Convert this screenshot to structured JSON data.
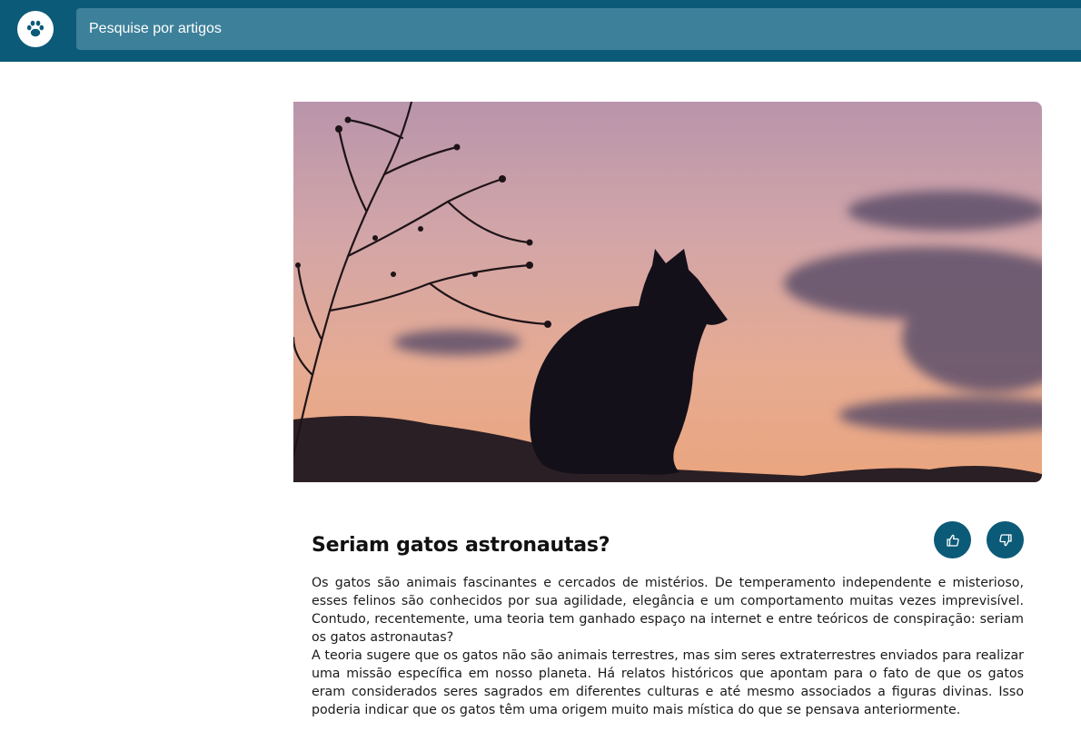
{
  "header": {
    "logo_icon": "paw-icon",
    "search_placeholder": "Pesquise por artigos",
    "background_color": "#0b5a78",
    "search_color": "#3d809a"
  },
  "article": {
    "image_description_icon": "cat-silhouette-sunset-image",
    "title": "Seriam gatos astronautas?",
    "like_icon": "thumbs-up-icon",
    "dislike_icon": "thumbs-down-icon",
    "paragraphs": [
      "Os gatos são animais fascinantes e cercados de mistérios. De temperamento independente e misterioso, esses felinos são conhecidos por sua agilidade, elegância e um comportamento muitas vezes imprevisível. Contudo, recentemente, uma teoria tem ganhado espaço na internet e entre teóricos de conspiração: seriam os gatos astronautas?",
      "A teoria sugere que os gatos não são animais terrestres, mas sim seres extraterrestres enviados para realizar uma missão específica em nosso planeta. Há relatos históricos que apontam para o fato de que os gatos eram considerados seres sagrados em diferentes culturas e até mesmo associados a figuras divinas. Isso poderia indicar que os gatos têm uma origem muito mais mística do que se pensava anteriormente."
    ]
  }
}
